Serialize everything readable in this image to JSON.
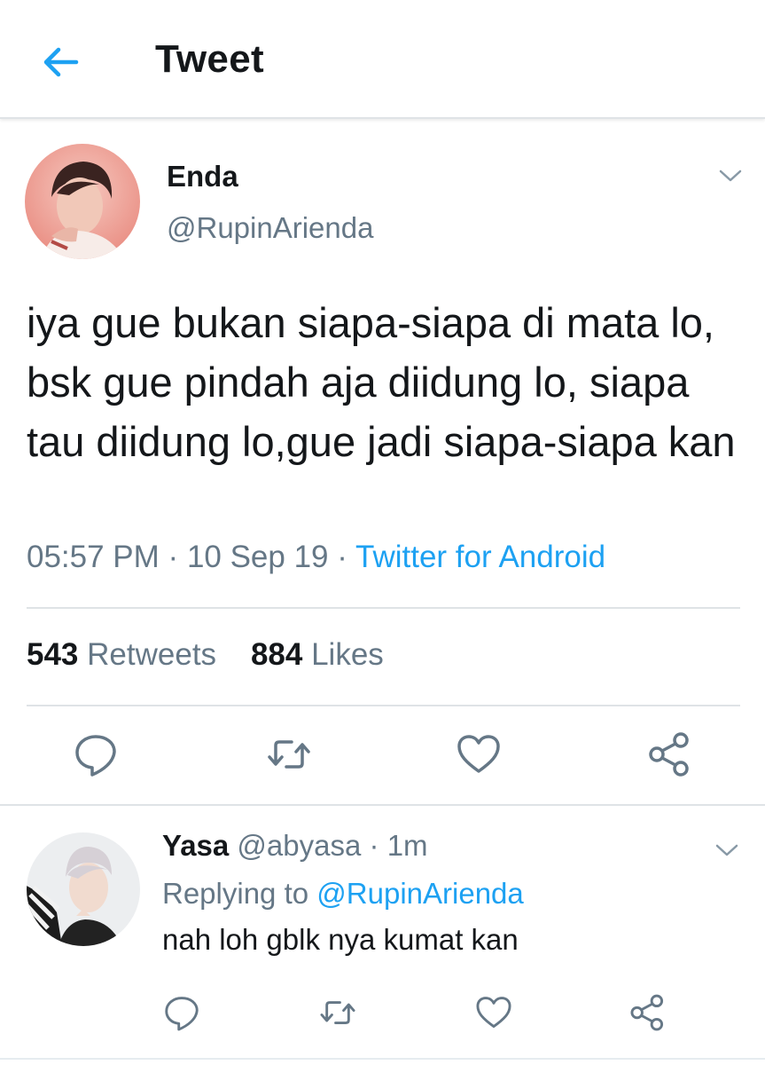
{
  "header": {
    "title": "Tweet",
    "back_icon": "arrow-left-icon"
  },
  "tweet": {
    "author": {
      "name": "Enda",
      "handle": "@RupinArienda"
    },
    "text": "iya gue bukan siapa-siapa di mata lo, bsk gue pindah aja diidung lo, siapa tau diidung lo,gue jadi siapa-siapa kan",
    "time": "05:57 PM",
    "date": "10 Sep 19",
    "separator": "·",
    "source": "Twitter for Android",
    "retweets": {
      "count": "543",
      "label": "Retweets"
    },
    "likes": {
      "count": "884",
      "label": "Likes"
    }
  },
  "reply": {
    "author": {
      "name": "Yasa",
      "handle": "@abyasa"
    },
    "time": "1m",
    "separator": "·",
    "replying_prefix": "Replying to",
    "replying_to": "@RupinArienda",
    "text": "nah loh gblk nya kumat kan"
  },
  "icons": {
    "reply": "reply-icon",
    "retweet": "retweet-icon",
    "like": "heart-icon",
    "share": "share-icon",
    "more": "chevron-down-icon"
  },
  "colors": {
    "accent": "#1da1f2",
    "secondary_text": "#657786",
    "primary_text": "#14171a",
    "divider": "#dfe3e6"
  }
}
